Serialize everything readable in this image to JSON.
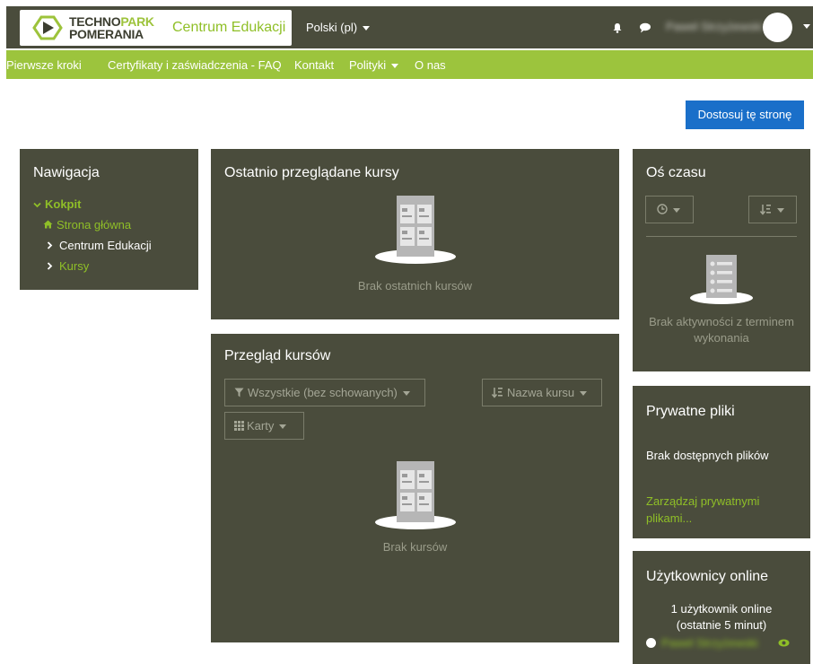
{
  "header": {
    "logo_line1_a": "TECHNO",
    "logo_line1_b": "PARK",
    "logo_line2": "POMERANIA",
    "site_name": "Centrum Edukacji",
    "language": "Polski (pl)",
    "user_name": "Paweł Strzyżewski"
  },
  "nav": {
    "items": [
      "Pierwsze kroki",
      "Certyfikaty i zaświadczenia - FAQ",
      "Kontakt",
      "Polityki",
      "O nas"
    ]
  },
  "page": {
    "customize_button": "Dostosuj tę stronę"
  },
  "navigation_block": {
    "title": "Nawigacja",
    "dashboard": "Kokpit",
    "home": "Strona główna",
    "education_center": "Centrum Edukacji",
    "courses": "Kursy"
  },
  "recent_block": {
    "title": "Ostatnio przeglądane kursy",
    "empty": "Brak ostatnich kursów"
  },
  "overview_block": {
    "title": "Przegląd kursów",
    "filter": "Wszystkie (bez schowanych)",
    "sort": "Nazwa kursu",
    "view": "Karty",
    "empty": "Brak kursów"
  },
  "timeline_block": {
    "title": "Oś czasu",
    "empty": "Brak aktywności z terminem wykonania"
  },
  "files_block": {
    "title": "Prywatne pliki",
    "empty": "Brak dostępnych plików",
    "manage_link": "Zarządzaj prywatnymi plikami..."
  },
  "online_block": {
    "title": "Użytkownicy online",
    "count": "1 użytkownik online",
    "period": "(ostatnie 5 minut)",
    "user_name": "Paweł Strzyżewski"
  },
  "colors": {
    "topbar": "#4a4c3c",
    "navbar": "#9cc43d",
    "accent_green": "#8fbf27",
    "primary_button": "#1a6fc9",
    "block_background": "#4a4c3c"
  }
}
